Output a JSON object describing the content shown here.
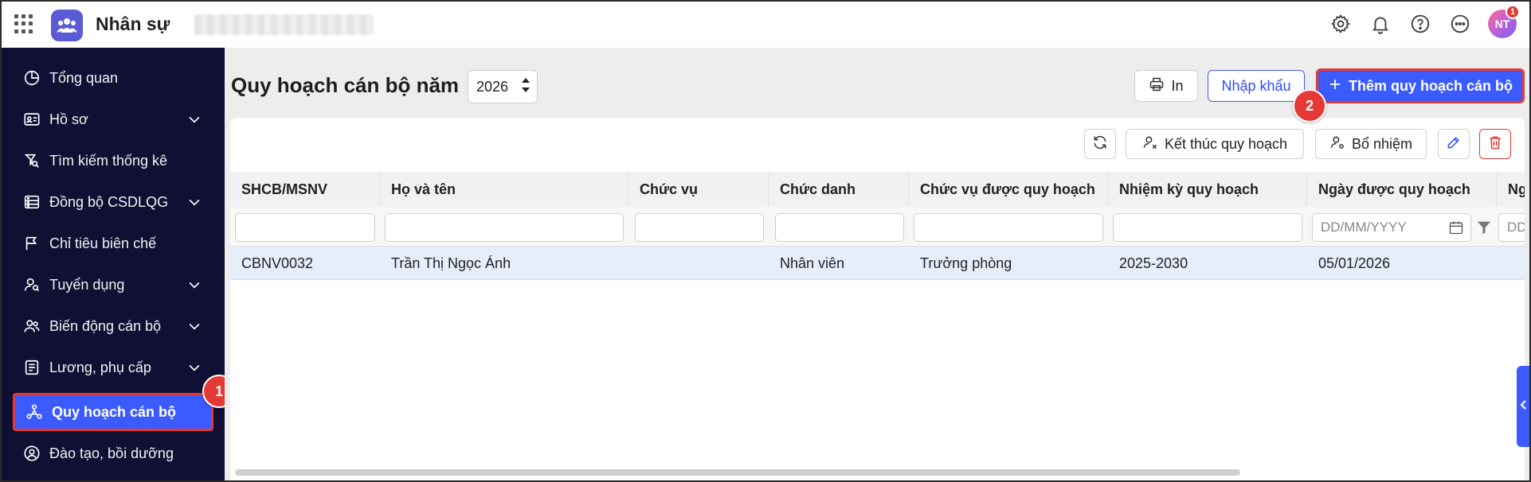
{
  "app": {
    "name": "Nhân sự",
    "user_initials": "NT",
    "notification_count": "1"
  },
  "sidebar": {
    "items": [
      {
        "label": "Tổng quan",
        "icon": "pie-chart-icon"
      },
      {
        "label": "Hồ sơ",
        "icon": "id-card-icon"
      },
      {
        "label": "Tìm kiếm thống kê",
        "icon": "search-stats-icon"
      },
      {
        "label": "Đồng bộ CSDLQG",
        "icon": "database-sync-icon"
      },
      {
        "label": "Chỉ tiêu biên chế",
        "icon": "flag-icon"
      },
      {
        "label": "Tuyển dụng",
        "icon": "user-search-icon"
      },
      {
        "label": "Biến động cán bộ",
        "icon": "users-icon"
      },
      {
        "label": "Lương, phụ cấp",
        "icon": "receipt-icon"
      },
      {
        "label": "Quy hoạch cán bộ",
        "icon": "org-chart-icon"
      },
      {
        "label": "Đào tạo, bồi dưỡng",
        "icon": "user-circle-icon"
      }
    ],
    "active_index": 8
  },
  "steps": {
    "step1": "1",
    "step2": "2"
  },
  "header": {
    "title": "Quy hoạch cán bộ năm",
    "year": "2026",
    "print_label": "In",
    "import_label": "Nhập khẩu",
    "add_label": "Thêm quy hoạch cán bộ"
  },
  "toolbar": {
    "end_plan_label": "Kết thúc quy hoạch",
    "appoint_label": "Bổ nhiệm"
  },
  "table": {
    "columns": [
      "SHCB/MSNV",
      "Họ và tên",
      "Chức vụ",
      "Chức danh",
      "Chức vụ được quy hoạch",
      "Nhiệm kỳ quy hoạch",
      "Ngày được quy hoạch",
      "Ng"
    ],
    "date_placeholder": "DD/MM/YYYY",
    "date_placeholder_cut": "DD",
    "rows": [
      {
        "code": "CBNV0032",
        "name": "Trần Thị Ngọc Ánh",
        "position": "",
        "title": "Nhân viên",
        "planned_position": "Trưởng phòng",
        "term": "2025-2030",
        "date": "05/01/2026"
      }
    ]
  },
  "colors": {
    "sidebar_bg": "#0f1034",
    "accent": "#3b5bff",
    "highlight": "#e53935",
    "row_selected": "#e6eefb"
  }
}
